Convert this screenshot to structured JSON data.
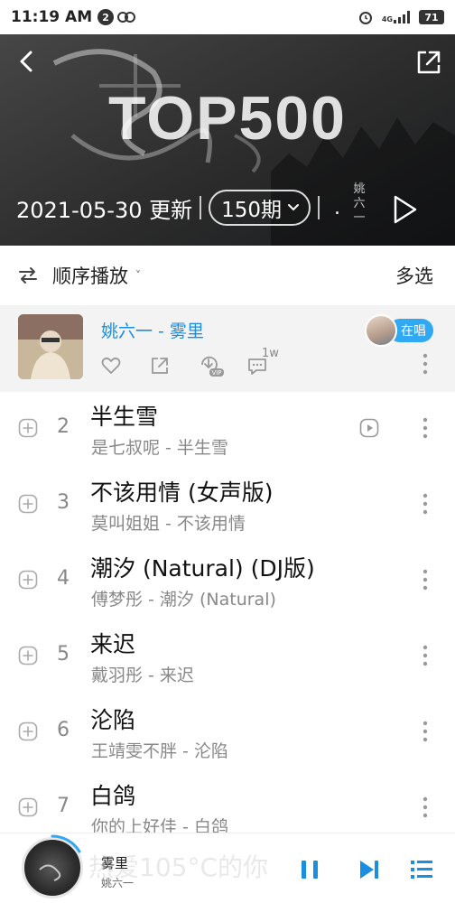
{
  "status_bar": {
    "time": "11:19 AM",
    "notification_count": "2",
    "network": "4G",
    "battery": "71"
  },
  "header": {
    "title": "TOP500",
    "update_date": "2021-05-30 更新",
    "period": "150期",
    "more_text": ".",
    "side_text": "姚六一"
  },
  "toolbar": {
    "order_label": "顺序播放",
    "multi_select_label": "多选"
  },
  "now_playing": {
    "title": "姚六一 - 雾里",
    "comment_count": "1w",
    "singing_label": "在唱"
  },
  "songs": [
    {
      "rank": "2",
      "title": "半生雪",
      "subtitle": "是七叔呢 - 半生雪",
      "has_mv": true
    },
    {
      "rank": "3",
      "title": "不该用情 (女声版)",
      "subtitle": "莫叫姐姐 - 不该用情",
      "has_mv": false
    },
    {
      "rank": "4",
      "title": "潮汐 (Natural) (DJ版)",
      "subtitle": "傅梦彤 - 潮汐 (Natural)",
      "has_mv": false
    },
    {
      "rank": "5",
      "title": "来迟",
      "subtitle": "戴羽彤 - 来迟",
      "has_mv": false
    },
    {
      "rank": "6",
      "title": "沦陷",
      "subtitle": "王靖雯不胖 - 沦陷",
      "has_mv": false
    },
    {
      "rank": "7",
      "title": "白鸽",
      "subtitle": "你的上好佳 - 白鸽",
      "has_mv": false
    }
  ],
  "mini_player": {
    "title": "雾里",
    "artist": "姚六一",
    "background_text": "热爱105°C的你"
  },
  "colors": {
    "accent": "#1a8fe0",
    "singing_badge": "#31a8f2",
    "player_controls": "#1a8fe0"
  }
}
